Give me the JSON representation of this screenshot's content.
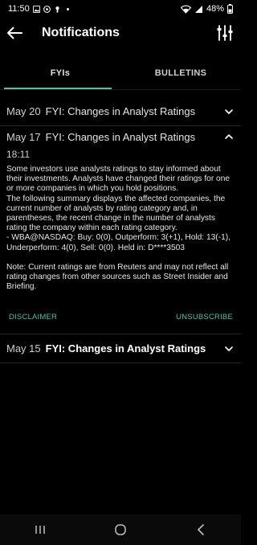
{
  "status_bar": {
    "time": "11:50",
    "battery": "48%"
  },
  "app_bar": {
    "title": "Notifications"
  },
  "tabs": [
    {
      "label": "FYIs",
      "active": true
    },
    {
      "label": "BULLETINS",
      "active": false
    }
  ],
  "items": [
    {
      "date": "May 20",
      "title": "FYI: Changes in Analyst Ratings",
      "expanded": false
    },
    {
      "date": "May 17",
      "title": "FYI: Changes in Analyst Ratings",
      "expanded": true,
      "time": "18:11",
      "body": "Some investors use analysts ratings to stay informed about their investments. Analysts have changed their ratings for one or more companies in which you hold positions.\nThe following summary displays the affected companies, the current number of analysts by rating category and, in parentheses, the recent change in the number of analysts rating the company within each rating category.\n- WBA@NASDAQ: Buy: 0(0), Outperform: 3(+1), Hold: 13(-1), Underperform: 4(0), Sell: 0(0). Held in: D****3503",
      "note": "Note: Current ratings are from Reuters and may not reflect all rating changes from other sources such as Street Insider and Briefing.",
      "disclaimer_label": "DISCLAIMER",
      "unsubscribe_label": "UNSUBSCRIBE"
    },
    {
      "date": "May 15",
      "title": "FYI: Changes in Analyst Ratings",
      "expanded": false
    }
  ],
  "colors": {
    "accent": "#4fc2a7",
    "background": "#000000"
  }
}
